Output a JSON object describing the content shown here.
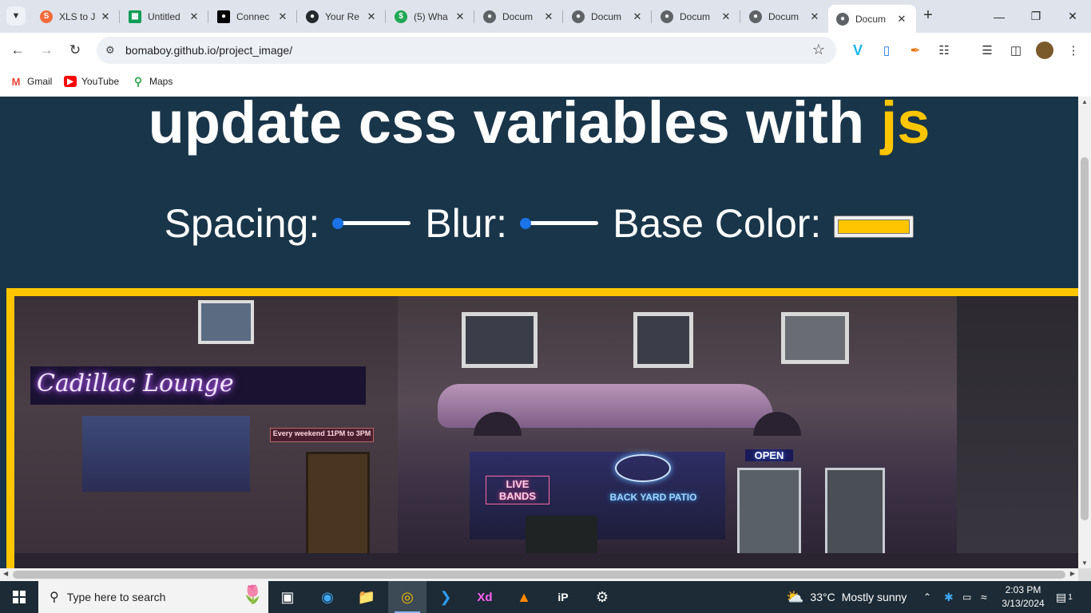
{
  "browser": {
    "tabs": [
      {
        "title": "XLS to J",
        "favicon": "xls-converter-icon",
        "color": "#f26b3a"
      },
      {
        "title": "Untitled",
        "favicon": "sheets-icon",
        "color": "#0f9d58"
      },
      {
        "title": "Connec",
        "favicon": "medium-icon",
        "color": "#000000"
      },
      {
        "title": "Your Re",
        "favicon": "github-icon",
        "color": "#24292e"
      },
      {
        "title": "(5) Wha",
        "favicon": "money-icon",
        "color": "#1fa855"
      },
      {
        "title": "Docum",
        "favicon": "globe-icon",
        "color": "#5f6368"
      },
      {
        "title": "Docum",
        "favicon": "globe-icon",
        "color": "#5f6368"
      },
      {
        "title": "Docum",
        "favicon": "globe-icon",
        "color": "#5f6368"
      },
      {
        "title": "Docum",
        "favicon": "globe-icon",
        "color": "#5f6368"
      },
      {
        "title": "Docum",
        "favicon": "globe-icon",
        "color": "#5f6368",
        "active": true
      }
    ],
    "url": "bomaboy.github.io/project_image/",
    "bookmarks": [
      {
        "label": "Gmail",
        "icon": "gmail-icon"
      },
      {
        "label": "YouTube",
        "icon": "youtube-icon"
      },
      {
        "label": "Maps",
        "icon": "maps-icon"
      }
    ]
  },
  "page": {
    "heading_main": "update css variables with ",
    "heading_accent": "js",
    "spacing_label": "Spacing:",
    "blur_label": "Blur:",
    "color_label": "Base Color:",
    "base_color": "#ffc600",
    "background_color": "#193549",
    "spacing_level": 0,
    "blur_level": 0
  },
  "photo_signs": {
    "lounge": "Cadillac Lounge",
    "weekend": "Every weekend 11PM to 3PM",
    "live": "LIVE BANDS",
    "open": "OPEN",
    "patio": "BACK YARD PATIO"
  },
  "taskbar": {
    "search_placeholder": "Type here to search",
    "weather_temp": "33°C",
    "weather_text": "Mostly sunny",
    "time": "2:03 PM",
    "date": "3/13/2024",
    "notifications": "1"
  }
}
